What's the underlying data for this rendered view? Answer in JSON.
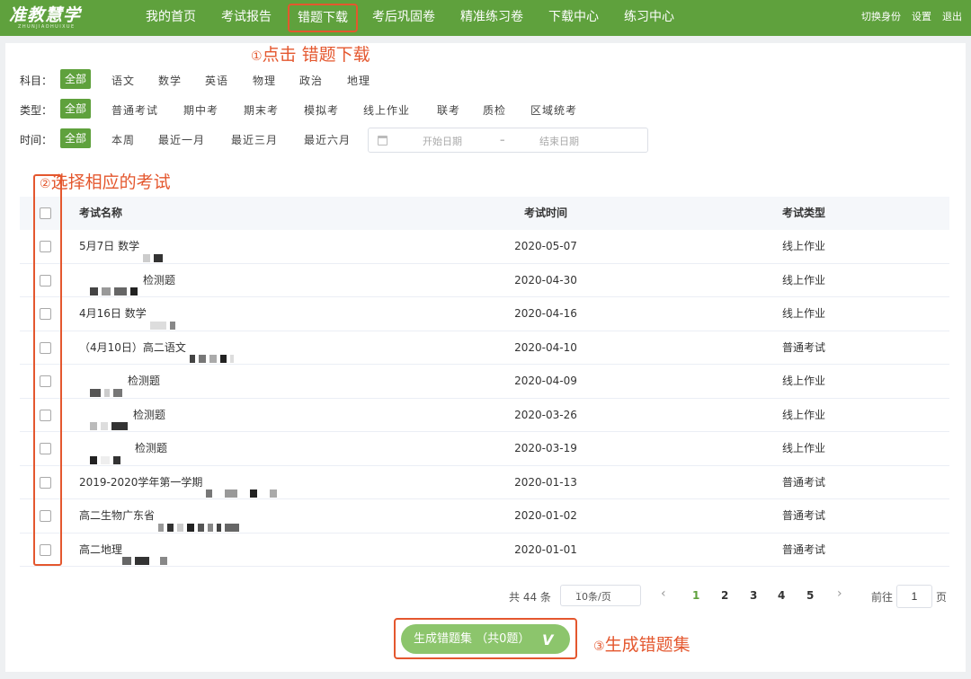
{
  "header": {
    "logo": "准教慧学",
    "logo_sub": "ZHUNJIAOHUIXUE",
    "nav": [
      "我的首页",
      "考试报告",
      "错题下载",
      "考后巩固卷",
      "精准练习卷",
      "下载中心",
      "练习中心"
    ],
    "right": [
      "切换身份",
      "设置",
      "退出"
    ],
    "brand_color": "#5fa13d"
  },
  "annotations": {
    "step1_num": "①",
    "step1": "点击 错题下载",
    "step2_num": "②",
    "step2": "选择相应的考试",
    "step3_num": "③",
    "step3": "生成错题集",
    "color": "#e4572e"
  },
  "filters": {
    "subject_label": "科目：",
    "subjects": [
      "全部",
      "语文",
      "数学",
      "英语",
      "物理",
      "政治",
      "地理"
    ],
    "type_label": "类型：",
    "types": [
      "全部",
      "普通考试",
      "期中考",
      "期末考",
      "模拟考",
      "线上作业",
      "联考",
      "质检",
      "区域统考"
    ],
    "time_label": "时间：",
    "times": [
      "全部",
      "本周",
      "最近一月",
      "最近三月",
      "最近六月"
    ],
    "start_placeholder": "开始日期",
    "range_sep": "–",
    "end_placeholder": "结束日期"
  },
  "table": {
    "headers": [
      "考试名称",
      "考试时间",
      "考试类型"
    ],
    "rows": [
      {
        "name": "5月7日 数学",
        "date": "2020-05-07",
        "type": "线上作业"
      },
      {
        "name": "检测题",
        "date": "2020-04-30",
        "type": "线上作业"
      },
      {
        "name": "4月16日 数学",
        "date": "2020-04-16",
        "type": "线上作业"
      },
      {
        "name": "（4月10日）高二语文",
        "date": "2020-04-10",
        "type": "普通考试"
      },
      {
        "name": "检测题",
        "date": "2020-04-09",
        "type": "线上作业"
      },
      {
        "name": "检测题",
        "date": "2020-03-26",
        "type": "线上作业"
      },
      {
        "name": "检测题",
        "date": "2020-03-19",
        "type": "线上作业"
      },
      {
        "name": "2019-2020学年第一学期",
        "date": "2020-01-13",
        "type": "普通考试"
      },
      {
        "name": "高二生物广东省",
        "date": "2020-01-02",
        "type": "普通考试"
      },
      {
        "name": "高二地理",
        "date": "2020-01-01",
        "type": "普通考试"
      }
    ]
  },
  "pagination": {
    "total": "共 44 条",
    "page_size": "10条/页",
    "pages": [
      "1",
      "2",
      "3",
      "4",
      "5"
    ],
    "current": "1",
    "goto_label": "前往",
    "goto_value": "1",
    "page_unit": "页"
  },
  "generate_button": "生成错题集 （共0题）"
}
